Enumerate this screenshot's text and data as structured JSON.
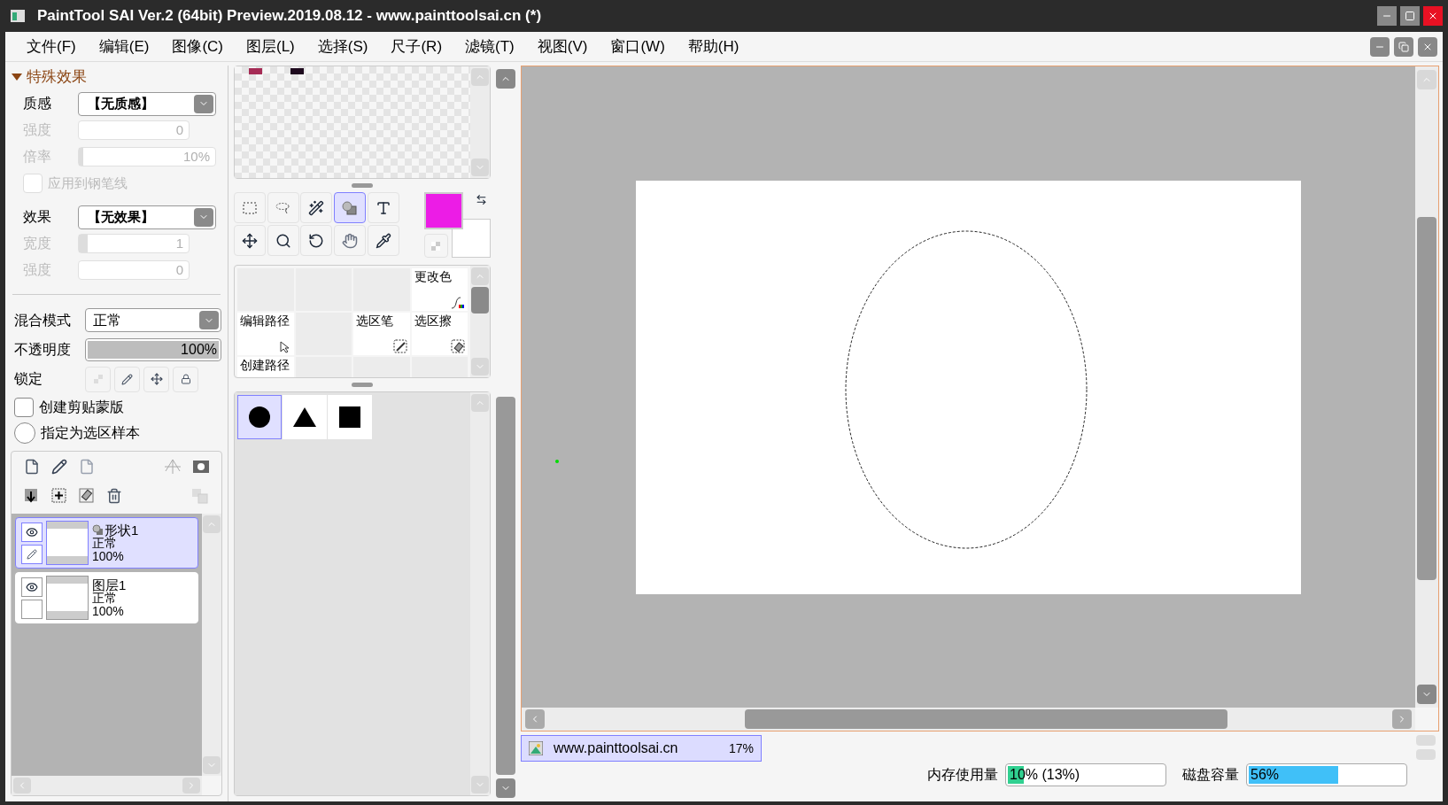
{
  "window": {
    "title": "PaintTool SAI Ver.2 (64bit) Preview.2019.08.12 - www.painttoolsai.cn (*)"
  },
  "menu": [
    "文件(F)",
    "编辑(E)",
    "图像(C)",
    "图层(L)",
    "选择(S)",
    "尺子(R)",
    "滤镜(T)",
    "视图(V)",
    "窗口(W)",
    "帮助(H)"
  ],
  "effects": {
    "title": "特殊效果",
    "expanded": true,
    "rows": [
      {
        "kind": "select",
        "label": "质感",
        "value": "【无质感】",
        "disabled": false
      },
      {
        "kind": "number",
        "label": "强度",
        "value": "0",
        "disabled": true
      },
      {
        "kind": "slider",
        "label": "倍率",
        "value": "10%",
        "level": 0.02,
        "disabled": true
      },
      {
        "kind": "checkbox",
        "label": "应用到钢笔线",
        "checked": false,
        "disabled": true
      },
      {
        "kind": "select",
        "label": "效果",
        "value": "【无效果】",
        "disabled": false
      },
      {
        "kind": "slider",
        "label": "宽度",
        "value": "1",
        "level": 0.08,
        "disabled": true
      },
      {
        "kind": "number",
        "label": "强度",
        "value": "0",
        "disabled": true
      }
    ]
  },
  "layer_props": {
    "blend_label": "混合模式",
    "blend_value": "正常",
    "opacity": {
      "label": "不透明度",
      "value": "100%",
      "level": 1
    },
    "lock_label": "锁定",
    "clipping": {
      "label": "创建剪贴蒙版",
      "checked": false
    },
    "selection_source": {
      "label": "指定为选区样本",
      "checked": false
    }
  },
  "layers": [
    {
      "kind": "shape",
      "name": "形状1",
      "mode": "正常",
      "opacity": "100%",
      "selected": true,
      "visible": true,
      "editing": true
    },
    {
      "kind": "raster",
      "name": "图层1",
      "mode": "正常",
      "opacity": "100%",
      "selected": false,
      "visible": true,
      "editing": false
    }
  ],
  "swatches": [
    {
      "color": "#a52b55"
    },
    {
      "color": "#1e0a1e"
    }
  ],
  "tools": [
    {
      "kind": "rect_select",
      "selected": false
    },
    {
      "kind": "lasso",
      "selected": false
    },
    {
      "kind": "wand",
      "selected": false
    },
    {
      "kind": "shape",
      "selected": true
    },
    {
      "kind": "text",
      "selected": false
    },
    {
      "kind": "move",
      "selected": false
    },
    {
      "kind": "zoom",
      "selected": false
    },
    {
      "kind": "rotate",
      "selected": false
    },
    {
      "kind": "hand",
      "selected": false
    },
    {
      "kind": "eyedropper",
      "selected": false
    }
  ],
  "colors": [
    {
      "kind": "primary",
      "color": "#ec1ce6"
    },
    {
      "kind": "secondary",
      "color": "#ffffff"
    }
  ],
  "brushes": [
    {
      "kind": "empty"
    },
    {
      "kind": "empty"
    },
    {
      "kind": "empty"
    },
    {
      "kind": "color_change",
      "label": "更改色"
    },
    {
      "kind": "edit_path",
      "label": "编辑路径"
    },
    {
      "kind": "empty"
    },
    {
      "kind": "select_pen",
      "label": "选区笔"
    },
    {
      "kind": "select_eraser",
      "label": "选区擦"
    },
    {
      "kind": "create_path",
      "label": "创建路径"
    },
    {
      "kind": "empty"
    },
    {
      "kind": "empty"
    },
    {
      "kind": "empty"
    }
  ],
  "shapes": [
    {
      "kind": "circle",
      "selected": true
    },
    {
      "kind": "triangle",
      "selected": false
    },
    {
      "kind": "square",
      "selected": false
    }
  ],
  "document_tab": {
    "name": "www.painttoolsai.cn",
    "zoom": "17%",
    "selected": true
  },
  "status": {
    "memory": {
      "label": "内存使用量",
      "value": "10% (13%)",
      "level": 0.1
    },
    "disk": {
      "label": "磁盘容量",
      "value": "56%",
      "level": 0.56
    }
  }
}
